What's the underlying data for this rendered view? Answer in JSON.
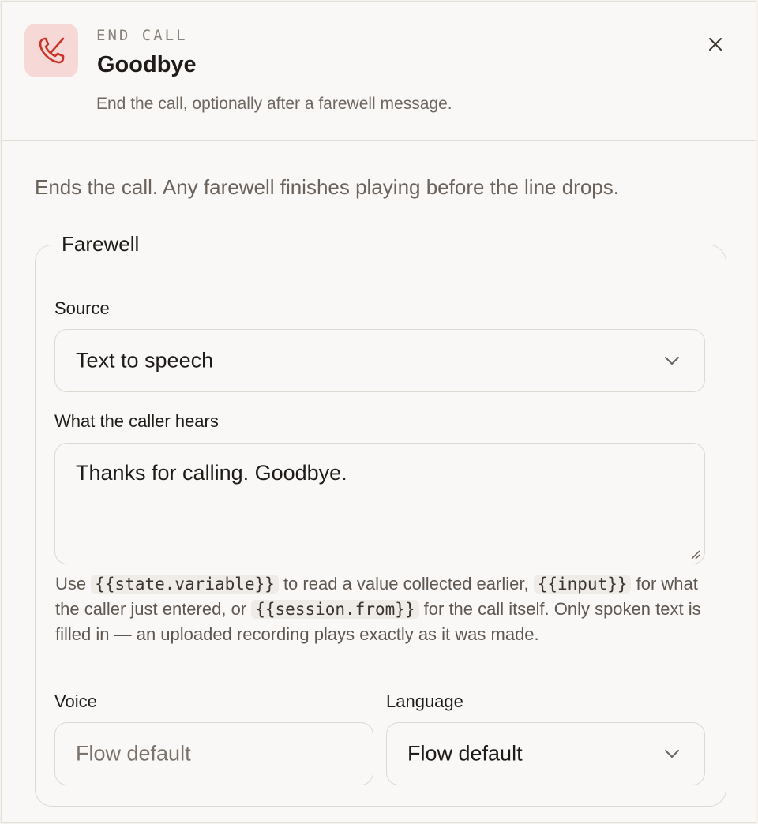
{
  "header": {
    "icon": "phone-hangup-icon",
    "kicker": "END CALL",
    "title": "Goodbye",
    "subtitle": "End the call, optionally after a farewell message.",
    "close_icon": "close-icon"
  },
  "description": "Ends the call. Any farewell finishes playing before the line drops.",
  "farewell": {
    "legend": "Farewell",
    "source": {
      "label": "Source",
      "value": "Text to speech"
    },
    "message": {
      "label": "What the caller hears",
      "value": "Thanks for calling. Goodbye."
    },
    "help": {
      "t1": "Use ",
      "c1": "{{state.variable}}",
      "t2": " to read a value collected earlier, ",
      "c2": "{{input}}",
      "t3": " for what the caller just entered, or ",
      "c3": "{{session.from}}",
      "t4": " for the call itself. Only spoken text is filled in — an uploaded recording plays exactly as it was made."
    },
    "voice": {
      "label": "Voice",
      "placeholder": "Flow default"
    },
    "language": {
      "label": "Language",
      "value": "Flow default"
    }
  },
  "colors": {
    "accent_red": "#c8342a",
    "icon_tile_bg": "#f6d9d6"
  }
}
